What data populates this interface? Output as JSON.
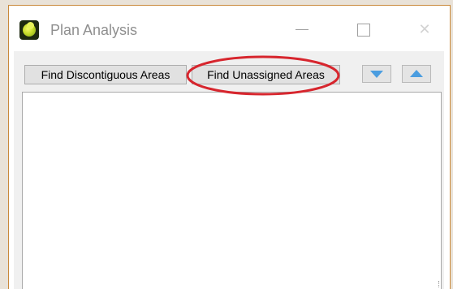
{
  "window": {
    "title": "Plan Analysis",
    "controls": {
      "minimize_icon": "minimize-icon",
      "maximize_icon": "maximize-icon",
      "close_icon": "close-icon",
      "close_glyph": "✕"
    },
    "app_icon": "plan-analysis-app-icon"
  },
  "toolbar": {
    "find_discontiguous_label": "Find Discontiguous Areas",
    "find_unassigned_label": "Find Unassigned Areas",
    "move_down_icon": "chevron-down-icon",
    "move_up_icon": "chevron-up-icon"
  },
  "results": {
    "items": []
  },
  "annotation": {
    "shape": "ellipse",
    "color": "#d7262e",
    "target": "find-unassigned-areas-button"
  },
  "colors": {
    "window_border": "#c9883a",
    "button_face": "#e1e1e1",
    "arrow_accent": "#4a9de0",
    "panel_bg": "#f0f0f0"
  }
}
